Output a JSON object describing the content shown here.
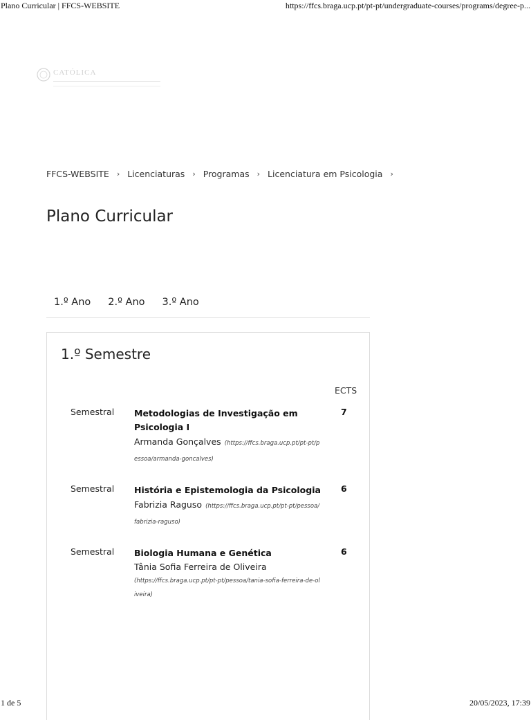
{
  "print_header": {
    "title": "Plano Curricular | FFCS-WEBSITE",
    "url": "https://ffcs.braga.ucp.pt/pt-pt/undergraduate-courses/programs/degree-p..."
  },
  "print_footer": {
    "page": "1 de 5",
    "datetime": "20/05/2023, 17:39"
  },
  "logo": {
    "text": "CATÓLICA",
    "icon": "catolica-logo"
  },
  "breadcrumb": {
    "items": [
      "FFCS-WEBSITE",
      "Licenciaturas",
      "Programas",
      "Licenciatura em Psicologia"
    ],
    "separator": "›"
  },
  "page_title": "Plano Curricular",
  "tabs": [
    "1.º Ano",
    "2.º Ano",
    "3.º Ano"
  ],
  "semester": {
    "title": "1.º Semestre",
    "ects_label": "ECTS",
    "courses": [
      {
        "type": "Semestral",
        "name": "Metodologias de Investigação em Psicologia I",
        "teacher": "Armanda Gonçalves",
        "url": "(https://ffcs.braga.ucp.pt/pt-pt/pessoa/armanda-goncalves)",
        "ects": "7"
      },
      {
        "type": "Semestral",
        "name": "História e Epistemologia da Psicologia",
        "teacher": "Fabrizia Raguso",
        "url": "(https://ffcs.braga.ucp.pt/pt-pt/pessoa/fabrizia-raguso)",
        "ects": "6"
      },
      {
        "type": "Semestral",
        "name": "Biologia Humana e Genética",
        "teacher": "Tânia Sofia Ferreira de Oliveira",
        "url": "(https://ffcs.braga.ucp.pt/pt-pt/pessoa/tania-sofia-ferreira-de-oliveira)",
        "ects": "6"
      }
    ]
  }
}
